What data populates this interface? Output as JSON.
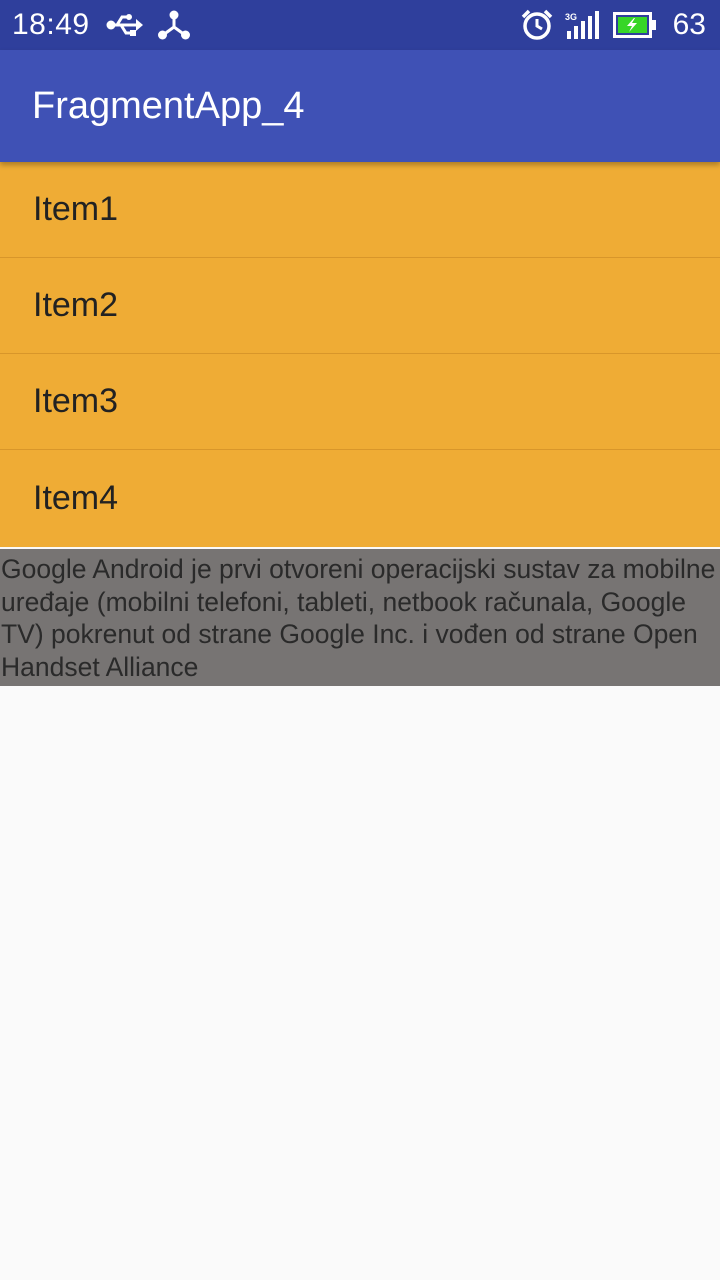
{
  "status_bar": {
    "time": "18:49",
    "battery_level": "63",
    "network_type": "3G",
    "icons": [
      "usb-icon",
      "share-icon",
      "alarm-icon",
      "signal-icon",
      "battery-icon"
    ],
    "background_color": "#2f3f9c"
  },
  "app_bar": {
    "title": "FragmentApp_4",
    "background_color": "#3f51b5"
  },
  "list": {
    "background_color": "#efac35",
    "items": [
      {
        "label": "Item1"
      },
      {
        "label": "Item2"
      },
      {
        "label": "Item3"
      },
      {
        "label": "Item4"
      }
    ]
  },
  "details": {
    "text": "Google Android je prvi otvoreni operacijski sustav za mobilne uređaje (mobilni telefoni, tableti, netbook računala, Google TV) pokrenut od strane Google Inc. i vođen od strane Open Handset Alliance",
    "background_color": "#777473"
  }
}
